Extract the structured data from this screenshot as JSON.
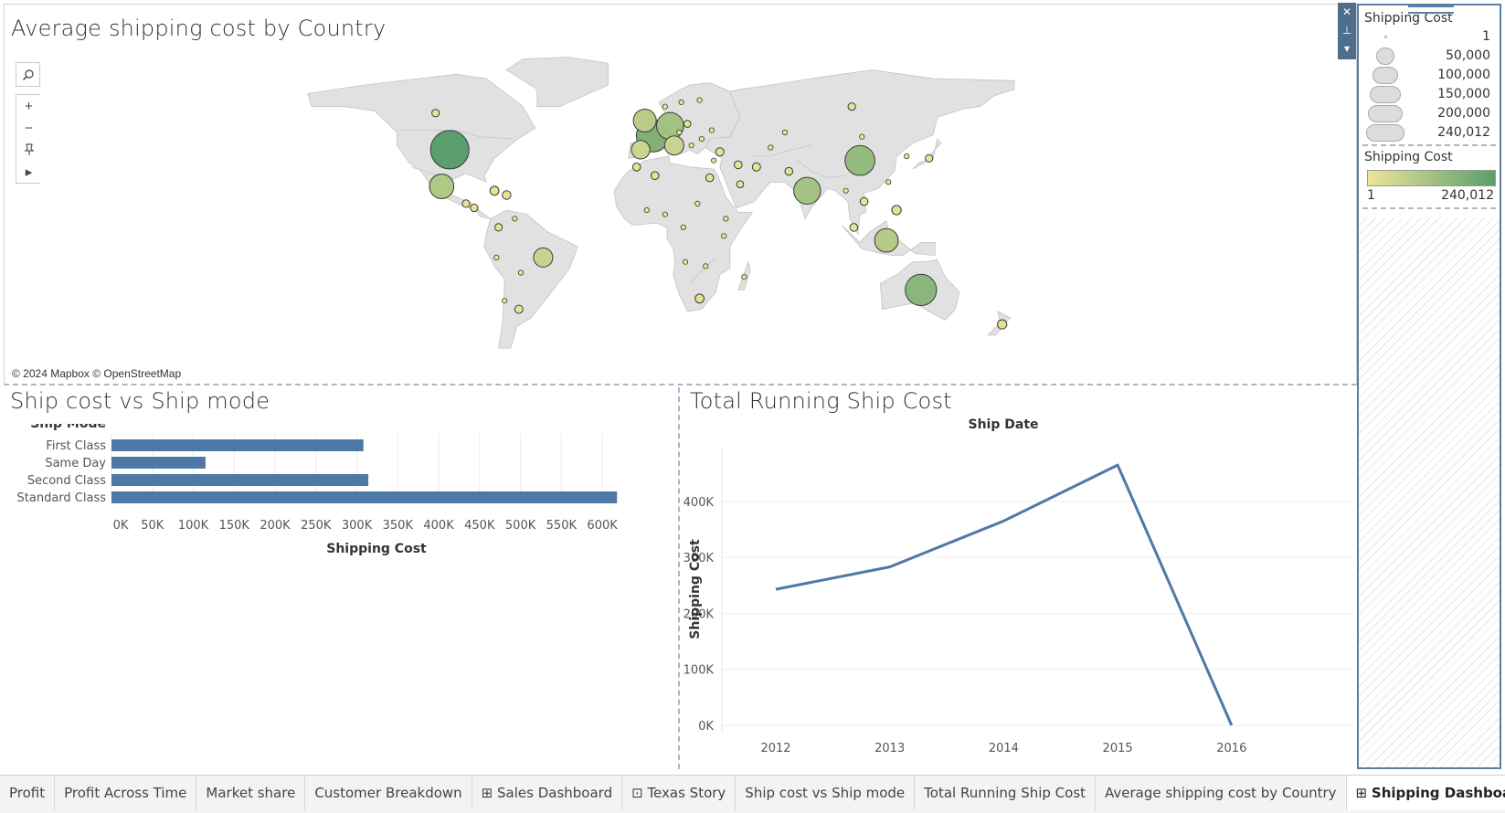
{
  "map_panel": {
    "title": "Average shipping cost by Country",
    "attribution": "© 2024 Mapbox © OpenStreetMap",
    "tools": {
      "search_icon": "magnifier",
      "zoom_in": "+",
      "zoom_out": "−",
      "pin_icon": "pin",
      "expand_icon": "▸"
    },
    "colors": {
      "land": "#e1e1e1",
      "border": "#c4c4c4",
      "low": "#ece597",
      "high": "#5a9e6d",
      "outline": "#3a3a3a"
    },
    "markers": [
      {
        "lon": -98,
        "lat": 40,
        "value": 240012
      },
      {
        "lon": -102,
        "lat": 23,
        "value": 98000
      },
      {
        "lon": 2,
        "lat": 46.5,
        "value": 175000
      },
      {
        "lon": 10.5,
        "lat": 51,
        "value": 120000
      },
      {
        "lon": -2,
        "lat": 53.5,
        "value": 85000
      },
      {
        "lon": 12.5,
        "lat": 42,
        "value": 60000
      },
      {
        "lon": -4,
        "lat": 40,
        "value": 55000
      },
      {
        "lon": 104,
        "lat": 35,
        "value": 145000
      },
      {
        "lon": 78,
        "lat": 21,
        "value": 118000
      },
      {
        "lon": 134,
        "lat": -25,
        "value": 160000
      },
      {
        "lon": 117,
        "lat": -2,
        "value": 90000
      },
      {
        "lon": -52,
        "lat": -10,
        "value": 60000
      },
      {
        "lon": 100,
        "lat": 60,
        "value": 9000
      },
      {
        "lon": -105,
        "lat": 57,
        "value": 9000
      },
      {
        "lon": 138,
        "lat": 36,
        "value": 9000
      },
      {
        "lon": 122,
        "lat": 12,
        "value": 14000
      },
      {
        "lon": 174,
        "lat": -41,
        "value": 14000
      },
      {
        "lon": 25,
        "lat": -29,
        "value": 13000
      },
      {
        "lon": -64,
        "lat": -34,
        "value": 11000
      },
      {
        "lon": -76,
        "lat": 21,
        "value": 13000
      },
      {
        "lon": -70,
        "lat": 19,
        "value": 12000
      },
      {
        "lon": -90,
        "lat": 15,
        "value": 9000
      },
      {
        "lon": -86,
        "lat": 13,
        "value": 9000
      },
      {
        "lon": -74,
        "lat": 4,
        "value": 9000
      },
      {
        "lon": 35,
        "lat": 39,
        "value": 11000
      },
      {
        "lon": 53,
        "lat": 32,
        "value": 11000
      },
      {
        "lon": 44,
        "lat": 33,
        "value": 10000
      },
      {
        "lon": 30,
        "lat": 27,
        "value": 10000
      },
      {
        "lon": 3,
        "lat": 28,
        "value": 10000
      },
      {
        "lon": -6,
        "lat": 32,
        "value": 10000
      },
      {
        "lon": 69,
        "lat": 30,
        "value": 10000
      },
      {
        "lon": 101,
        "lat": 4,
        "value": 10000
      },
      {
        "lon": 106,
        "lat": 16,
        "value": 10000
      },
      {
        "lon": 45,
        "lat": 24,
        "value": 8000
      },
      {
        "lon": 19,
        "lat": 52,
        "value": 8000
      },
      {
        "lon": 105,
        "lat": 46,
        "value": 4000
      },
      {
        "lon": 127,
        "lat": 37,
        "value": 4000
      },
      {
        "lon": 8,
        "lat": 60,
        "value": 4000
      },
      {
        "lon": 25,
        "lat": 63,
        "value": 4000
      },
      {
        "lon": 16,
        "lat": 62,
        "value": 4000
      },
      {
        "lon": 97,
        "lat": 21,
        "value": 4000
      },
      {
        "lon": 118,
        "lat": 25,
        "value": 4000
      },
      {
        "lon": 8,
        "lat": 10,
        "value": 4000
      },
      {
        "lon": 38,
        "lat": 8,
        "value": 4000
      },
      {
        "lon": 37,
        "lat": 0,
        "value": 4000
      },
      {
        "lon": 47,
        "lat": -19,
        "value": 4000
      },
      {
        "lon": -63,
        "lat": -17,
        "value": 4000
      },
      {
        "lon": -75,
        "lat": -10,
        "value": 4000
      },
      {
        "lon": -71,
        "lat": -30,
        "value": 4000
      },
      {
        "lon": -66,
        "lat": 8,
        "value": 4000
      },
      {
        "lon": 18,
        "lat": -12,
        "value": 4000
      },
      {
        "lon": 28,
        "lat": -14,
        "value": 4000
      },
      {
        "lon": 24,
        "lat": 15,
        "value": 4000
      },
      {
        "lon": 17,
        "lat": 4,
        "value": 4000
      },
      {
        "lon": -1,
        "lat": 12,
        "value": 4000
      },
      {
        "lon": 67,
        "lat": 48,
        "value": 4000
      },
      {
        "lon": 60,
        "lat": 41,
        "value": 4000
      },
      {
        "lon": 31,
        "lat": 49,
        "value": 4000
      },
      {
        "lon": 26,
        "lat": 45,
        "value": 4000
      },
      {
        "lon": 21,
        "lat": 42,
        "value": 4000
      },
      {
        "lon": 15,
        "lat": 48,
        "value": 4000
      },
      {
        "lon": 32,
        "lat": 35,
        "value": 4000
      }
    ]
  },
  "bar_panel": {
    "title": "Ship cost vs Ship mode"
  },
  "line_panel": {
    "title": "Total Running Ship Cost"
  },
  "chart_data": [
    {
      "type": "bar",
      "title": "Ship cost vs Ship mode",
      "category_label": "Ship Mode",
      "categories": [
        "First Class",
        "Same Day",
        "Second Class",
        "Standard Class"
      ],
      "values": [
        308000,
        115000,
        314000,
        618000
      ],
      "xlabel": "Shipping Cost",
      "xlim": [
        0,
        640000
      ],
      "ticks": [
        "0K",
        "50K",
        "100K",
        "150K",
        "200K",
        "250K",
        "300K",
        "350K",
        "400K",
        "450K",
        "500K",
        "550K",
        "600K"
      ],
      "tick_values": [
        0,
        50000,
        100000,
        150000,
        200000,
        250000,
        300000,
        350000,
        400000,
        450000,
        500000,
        550000,
        600000
      ],
      "color": "#4e79a7",
      "grid": true
    },
    {
      "type": "line",
      "title": "Total Running Ship Cost",
      "xlabel": "Ship Date",
      "ylabel": "Shipping Cost",
      "x": [
        "2012",
        "2013",
        "2014",
        "2015",
        "2016"
      ],
      "values": [
        243000,
        283000,
        365000,
        465000,
        0
      ],
      "ylim": [
        0,
        470000
      ],
      "yticks": [
        "0K",
        "100K",
        "200K",
        "300K",
        "400K"
      ],
      "ytick_values": [
        0,
        100000,
        200000,
        300000,
        400000
      ],
      "color": "#4e79a7",
      "grid": true
    }
  ],
  "legend": {
    "size_title": "Shipping Cost",
    "size_items": [
      {
        "label": "1",
        "value": 1
      },
      {
        "label": "50,000",
        "value": 50000
      },
      {
        "label": "100,000",
        "value": 100000
      },
      {
        "label": "150,000",
        "value": 150000
      },
      {
        "label": "200,000",
        "value": 200000
      },
      {
        "label": "240,012",
        "value": 240012
      }
    ],
    "color_title": "Shipping Cost",
    "color_min": "1",
    "color_max": "240,012"
  },
  "float_controls": {
    "close": "✕",
    "pin": "⊥",
    "menu": "▾"
  },
  "tabs": [
    {
      "label": "Profit",
      "icon": ""
    },
    {
      "label": "Profit Across Time",
      "icon": ""
    },
    {
      "label": "Market share",
      "icon": ""
    },
    {
      "label": "Customer Breakdown",
      "icon": ""
    },
    {
      "label": "Sales Dashboard",
      "icon": "⊞"
    },
    {
      "label": "Texas Story",
      "icon": "⊡"
    },
    {
      "label": "Ship cost vs Ship mode",
      "icon": ""
    },
    {
      "label": "Total Running Ship Cost",
      "icon": ""
    },
    {
      "label": "Average shipping cost by Country",
      "icon": ""
    },
    {
      "label": "Shipping Dashboard",
      "icon": "⊞"
    }
  ],
  "active_tab": 9,
  "tab_buttons": [
    "new-worksheet-icon",
    "new-dashboard-icon",
    "new-story-icon"
  ]
}
